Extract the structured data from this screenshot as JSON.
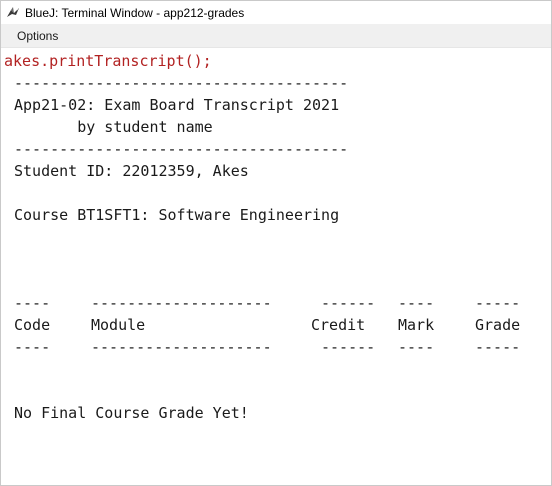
{
  "window": {
    "title": "BlueJ: Terminal Window - app212-grades"
  },
  "menu": {
    "items": [
      "Options"
    ]
  },
  "terminal": {
    "command": "akes.printTranscript();",
    "rule": "-------------------------------------",
    "header_line1": "App21-02: Exam Board Transcript 2021",
    "header_line2": "       by student name",
    "student_line": "Student ID: 22012359, Akes",
    "course_line": "Course BT1SFT1: Software Engineering",
    "table": {
      "columns": [
        {
          "label": "Code",
          "dashes": "----"
        },
        {
          "label": "Module",
          "dashes": "--------------------"
        },
        {
          "label": "Credit",
          "dashes": "------"
        },
        {
          "label": "Mark",
          "dashes": "----"
        },
        {
          "label": "Grade",
          "dashes": "-----"
        }
      ]
    },
    "final_message": "No Final Course Grade Yet!"
  }
}
